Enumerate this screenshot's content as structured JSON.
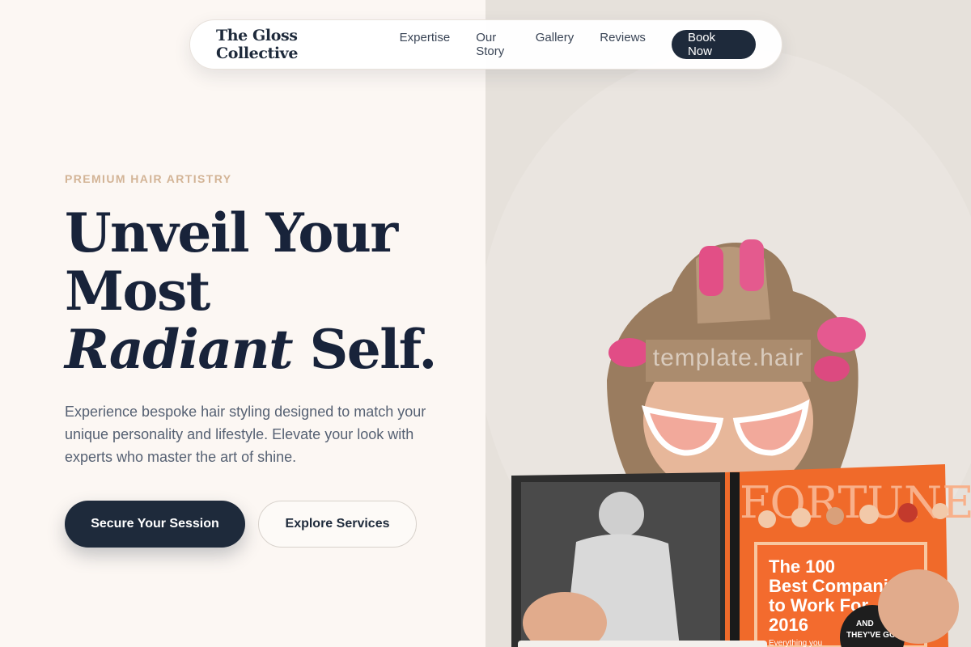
{
  "nav": {
    "brand": "The Gloss Collective",
    "links": [
      "Expertise",
      "Our Story",
      "Gallery",
      "Reviews"
    ],
    "cta": "Book Now"
  },
  "hero": {
    "eyebrow": "PREMIUM HAIR ARTISTRY",
    "headline_line1": "Unveil Your",
    "headline_line2": "Most",
    "headline_italic": "Radiant",
    "headline_end": "Self.",
    "lead": "Experience bespoke hair styling designed to match your unique personality and lifestyle. Elevate your look with experts who master the art of shine.",
    "primary_cta": "Secure Your Session",
    "secondary_cta": "Explore Services"
  },
  "image": {
    "watermark": "template.hair",
    "magazine_title": "FORTUNE",
    "magazine_headline": "The 100 Best Companies to Work For 2016",
    "magazine_tag": "AND THEY'VE GOT",
    "magazine_snippet": "Everything you"
  },
  "colors": {
    "navy": "#1e2a3b",
    "cream": "#fcf7f3",
    "accent_tan": "#d3b496",
    "magazine_orange": "#f06a2a"
  }
}
